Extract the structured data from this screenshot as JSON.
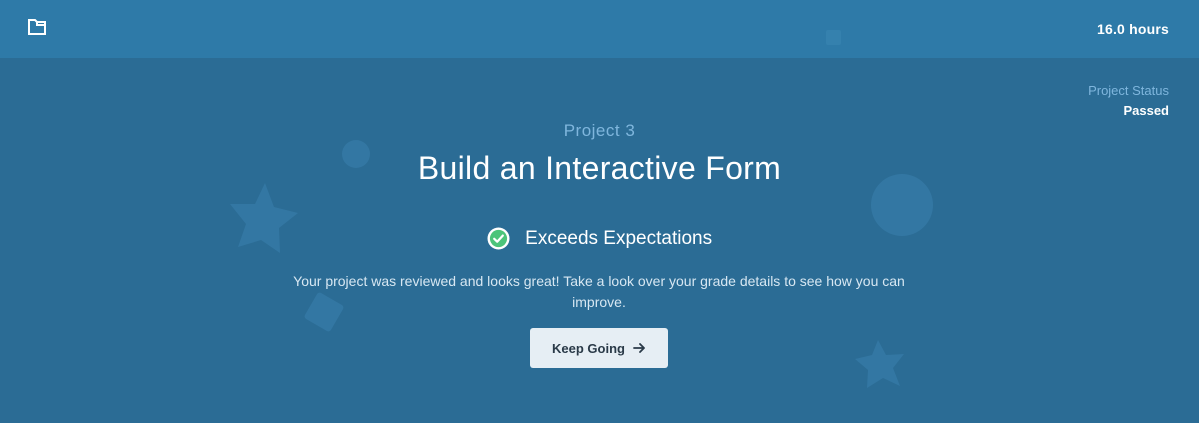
{
  "header": {
    "folder_icon": "folder-icon",
    "hours": "16.0 hours"
  },
  "status": {
    "label": "Project Status",
    "value": "Passed"
  },
  "project": {
    "number": "Project 3",
    "title": "Build an Interactive Form"
  },
  "grade": {
    "icon": "check-circle-icon",
    "label": "Exceeds Expectations",
    "description": "Your project was reviewed and looks great! Take a look over your grade details to see how you can improve."
  },
  "action": {
    "label": "Keep Going",
    "icon": "arrow-right-icon"
  },
  "colors": {
    "background": "#2b6c95",
    "header": "#2e7aa8",
    "accent_text": "#7fb6dd",
    "success": "#4cc47a",
    "button": "#e6eef4"
  }
}
